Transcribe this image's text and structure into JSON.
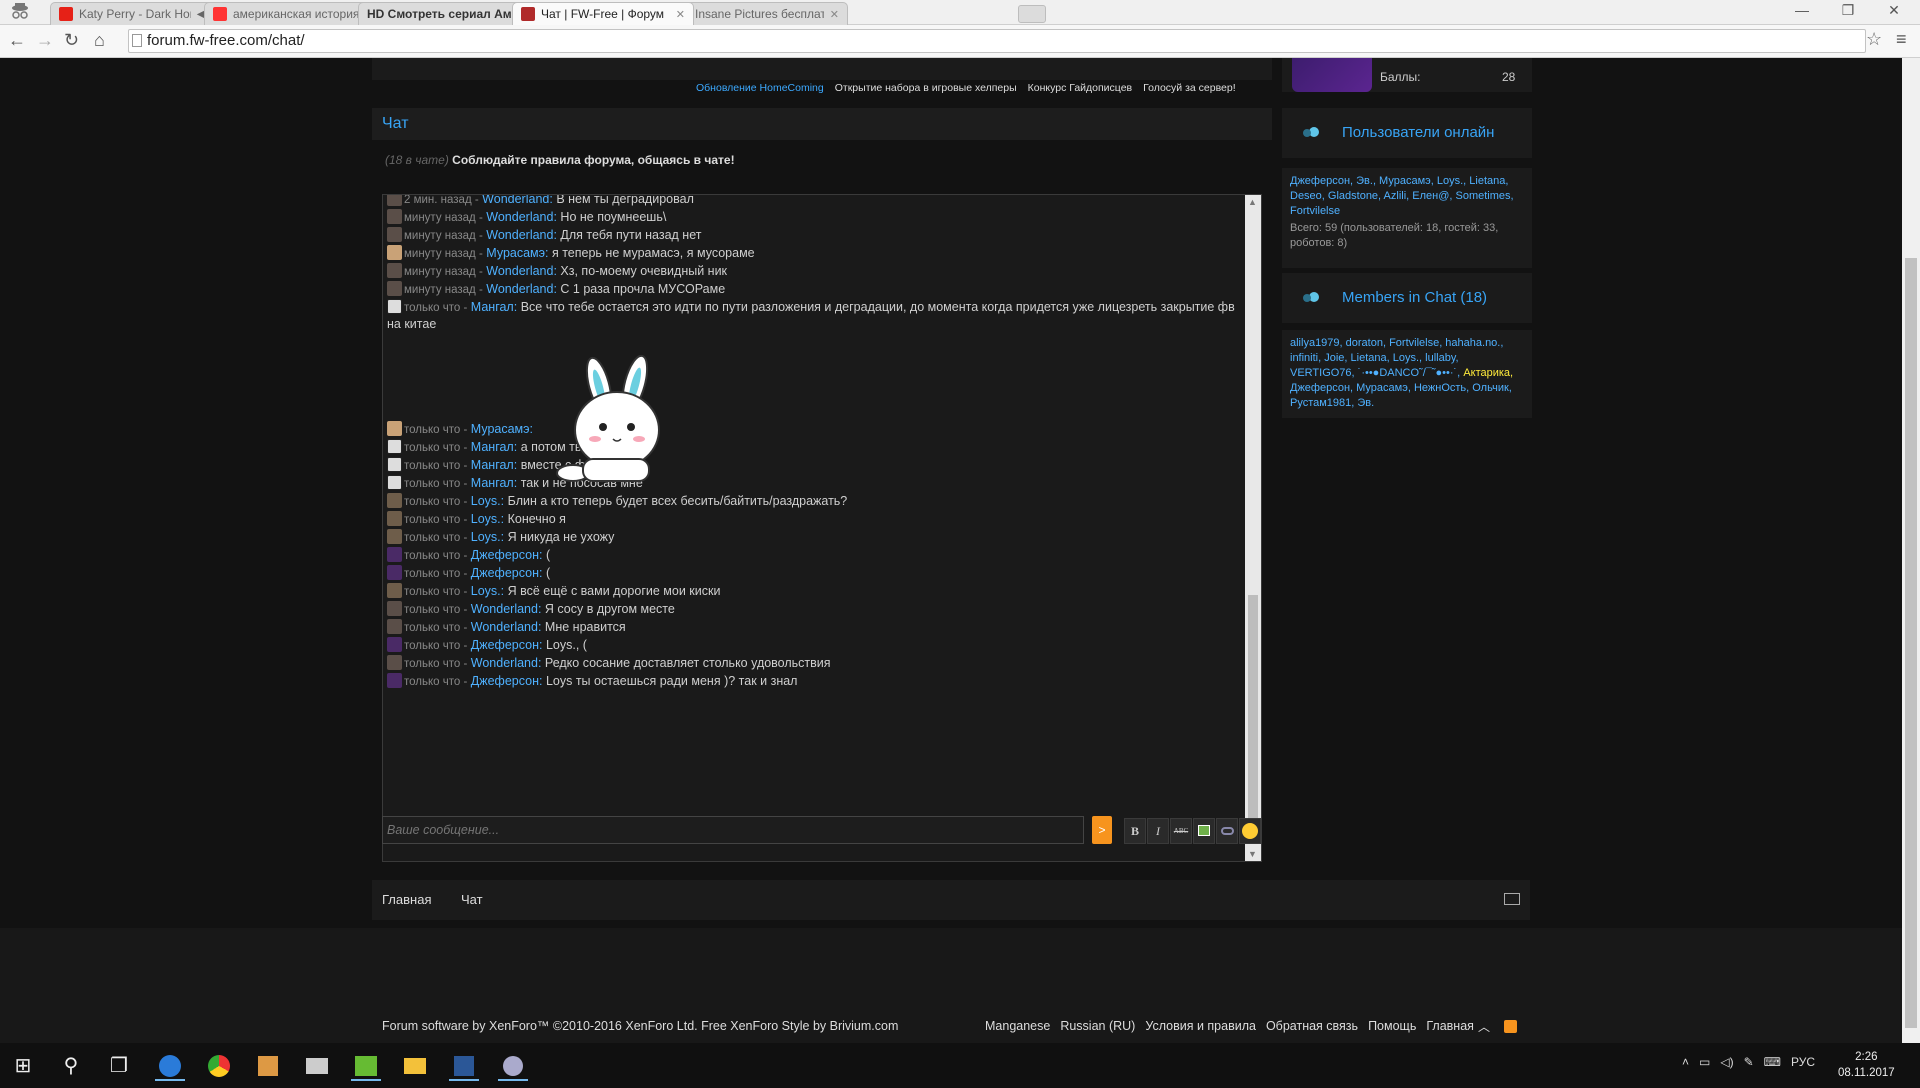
{
  "browser": {
    "tabs": [
      {
        "label": "Katy Perry - Dark Horse",
        "favicon_color": "#e62117"
      },
      {
        "label": "американская история у",
        "favicon_color": "#ff3333"
      },
      {
        "label": "HD Смотреть сериал Амери",
        "favicon_color": "#333333"
      },
      {
        "label": "Чат | FW-Free | Форум",
        "favicon_color": "#b02a2a",
        "active": true
      },
      {
        "label": "Insane Pictures бесплатн",
        "favicon_color": "#2d5f9a"
      }
    ],
    "url": "forum.fw-free.com/chat/"
  },
  "notices": [
    "Обновление HomeComing",
    "Открытие набора в игровые хелперы",
    "Конкурс Гайдописцев",
    "Голосуй за сервер!"
  ],
  "chat": {
    "title": "Чат",
    "count_text": "(18 в чате)",
    "rules_text": "Соблюдайте правила форума, общаясь в чате!",
    "messages": [
      {
        "time": "2 мин. назад -",
        "user": "Wonderland:",
        "text": "В нем ты деградировал",
        "av": "w"
      },
      {
        "time": "минуту назад -",
        "user": "Wonderland:",
        "text": "Но не поумнеешь\\",
        "av": "w"
      },
      {
        "time": "минуту назад -",
        "user": "Wonderland:",
        "text": "Для тебя пути назад нет",
        "av": "w"
      },
      {
        "time": "минуту назад -",
        "user": "Мурасамэ:",
        "text": "я теперь не мурамасэ, я мусораме",
        "av": "m"
      },
      {
        "time": "минуту назад -",
        "user": "Wonderland:",
        "text": "Хз, по-моему очевидный ник",
        "av": "w"
      },
      {
        "time": "минуту назад -",
        "user": "Wonderland:",
        "text": "С 1 раза прочла МУСОРаме",
        "av": "w"
      },
      {
        "time": "только что -",
        "user": "Мангал:",
        "text": "Все что тебе остается это идти по пути разложения и деградации, до момента когда придется уже лицезреть закрытие фв на китае",
        "av": "g"
      },
      {
        "time": "только что -",
        "user": "Мурасамэ:",
        "text": "",
        "av": "m"
      },
      {
        "time": "только что -",
        "user": "Мангал:",
        "text": "а потом ты умрешь",
        "av": "g"
      },
      {
        "time": "только что -",
        "user": "Мангал:",
        "text": "вместе с фв",
        "av": "g"
      },
      {
        "time": "только что -",
        "user": "Мангал:",
        "text": "так и не пососав мне",
        "av": "g"
      },
      {
        "time": "только что -",
        "user": "Loys.:",
        "text": "Блин а кто теперь будет всех бесить/байтить/раздражать?",
        "av": "l"
      },
      {
        "time": "только что -",
        "user": "Loys.:",
        "text": "Конечно я",
        "av": "l"
      },
      {
        "time": "только что -",
        "user": "Loys.:",
        "text": "Я никуда не ухожу",
        "av": "l"
      },
      {
        "time": "только что -",
        "user": "Джеферсон:",
        "text": "(",
        "av": "j"
      },
      {
        "time": "только что -",
        "user": "Джеферсон:",
        "text": "(",
        "av": "j"
      },
      {
        "time": "только что -",
        "user": "Loys.:",
        "text": "Я всё ещё с вами дорогие мои киски",
        "av": "l"
      },
      {
        "time": "только что -",
        "user": "Wonderland:",
        "text": "Я сосу в другом месте",
        "av": "w"
      },
      {
        "time": "только что -",
        "user": "Wonderland:",
        "text": "Мне нравится",
        "av": "w"
      },
      {
        "time": "только что -",
        "user": "Джеферсон:",
        "text": "Loys., (",
        "av": "j"
      },
      {
        "time": "только что -",
        "user": "Wonderland:",
        "text": "Редко сосание доставляет столько удовольствия",
        "av": "w"
      },
      {
        "time": "только что -",
        "user": "Джеферсон:",
        "text": "Loys ты остаешься ради меня )? так и знал",
        "av": "j"
      }
    ],
    "input_placeholder": "Ваше сообщение...",
    "send_label": ">",
    "format_buttons": [
      "B",
      "I",
      "ABC"
    ]
  },
  "sidebar": {
    "points_label": "Баллы:",
    "points_value": "28",
    "online_title": "Пользователи онлайн",
    "online_users": "Джеферсон, Эв., Мурасамэ, Loys., Lietana, Deseo, Gladstone, Azlili, Елен@, Sometimes, Fortvilelse",
    "online_stats": "Всего: 59 (пользователей: 18, гостей: 33, роботов: 8)",
    "chat_title": "Members in Chat (18)",
    "chat_users_a": "alilya1979, doraton, Fortvilelse, hahaha.no., infiniti, Joie, Lietana, Loys., lullaby, VERTIGO76, ˙·••●DANCO˜/¯˜●••·˙,",
    "chat_users_yellow": "Актарика,",
    "chat_users_b": "Джеферсон, Мурасамэ, НежнОсть, Ольчик, Рустам1981, Эв."
  },
  "footer": {
    "nav": [
      "Главная",
      "Чат"
    ],
    "copyright": "Forum software by XenForo™ ©2010-2016 XenForo Ltd. Free XenForo Style by Brivium.com",
    "links": [
      "Manganese",
      "Russian (RU)",
      "Условия и правила",
      "Обратная связь",
      "Помощь",
      "Главная"
    ]
  },
  "taskbar": {
    "lang": "РУС",
    "time": "2:26",
    "date": "08.11.2017"
  }
}
